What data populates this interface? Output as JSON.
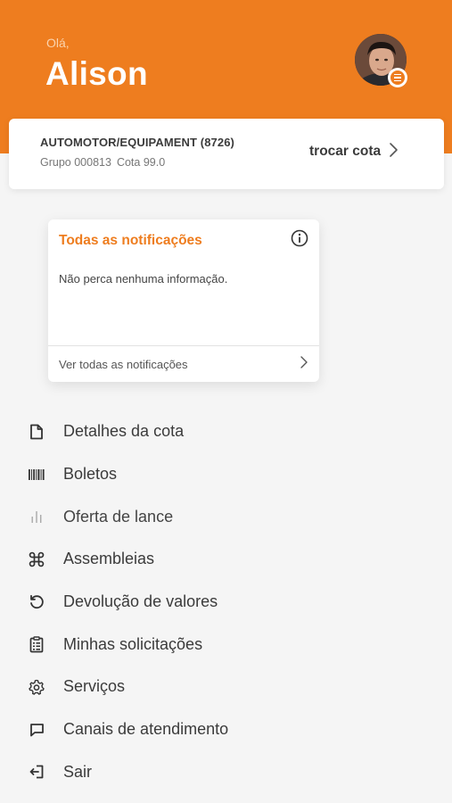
{
  "header": {
    "greeting": "Olá,",
    "user_name": "Alison",
    "accent_color": "#ee7d1f"
  },
  "quota": {
    "title": "AUTOMOTOR/EQUIPAMENT (8726)",
    "group": "Grupo 000813",
    "quota": "Cota 99.0",
    "switch_label": "trocar cota",
    "switch_icon": "chevron-right-icon"
  },
  "notifications": {
    "title": "Todas as notificações",
    "info_icon": "info-icon",
    "message": "Não perca nenhuma informação.",
    "see_all_label": "Ver todas as notificações"
  },
  "menu": {
    "items": [
      {
        "label": "Detalhes da cota",
        "icon": "document-icon"
      },
      {
        "label": "Boletos",
        "icon": "barcode-icon"
      },
      {
        "label": "Oferta de lance",
        "icon": "bar-chart-icon"
      },
      {
        "label": "Assembleias",
        "icon": "command-icon"
      },
      {
        "label": "Devolução de valores",
        "icon": "undo-icon"
      },
      {
        "label": "Minhas solicitações",
        "icon": "clipboard-icon"
      },
      {
        "label": "Serviços",
        "icon": "gear-icon"
      },
      {
        "label": "Canais de atendimento",
        "icon": "chat-icon"
      },
      {
        "label": "Sair",
        "icon": "logout-icon"
      }
    ]
  }
}
